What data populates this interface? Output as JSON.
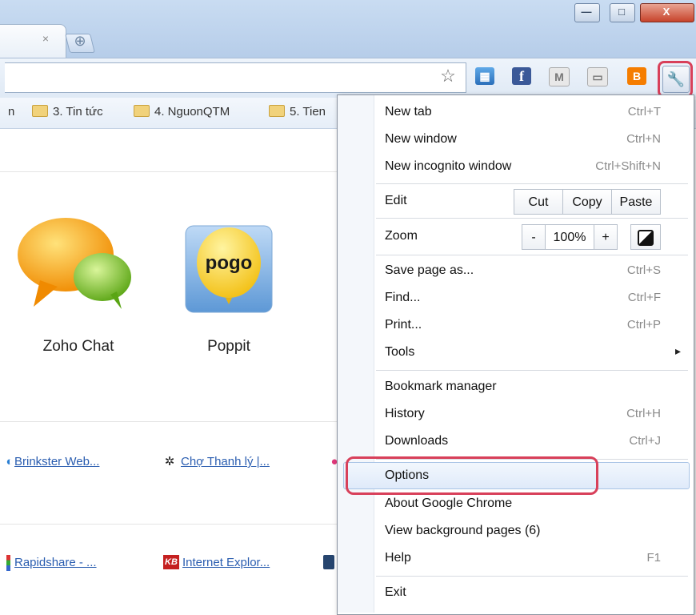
{
  "window": {
    "close_glyph": "X",
    "minimize_glyph": "—",
    "maximize_glyph": "□"
  },
  "tab": {
    "close_glyph": "×",
    "new_tab_glyph": "⊕"
  },
  "toolbar": {
    "star_glyph": "☆",
    "extensions": [
      {
        "icon": "calendar-icon",
        "glyph": "▦"
      },
      {
        "icon": "facebook-icon",
        "glyph": "f"
      },
      {
        "icon": "gmail-checker-icon",
        "glyph": "M"
      },
      {
        "icon": "chat-checker-icon",
        "glyph": "▭"
      },
      {
        "icon": "blogger-icon",
        "glyph": "B"
      }
    ],
    "wrench_glyph": "🔧",
    "highlight_color": "#d8405a"
  },
  "bookmarks": [
    {
      "label": "n"
    },
    {
      "label": "3. Tin tức"
    },
    {
      "label": "4. NguonQTM"
    },
    {
      "label": "5. Tien"
    }
  ],
  "apps": [
    {
      "label": "Zoho Chat"
    },
    {
      "label": "Poppit",
      "logo_text": "pogo"
    }
  ],
  "links": {
    "row1": [
      {
        "label": "Brinkster Web..."
      },
      {
        "label": "Chợ Thanh lý |..."
      }
    ],
    "row2": [
      {
        "label": "Rapidshare - ..."
      },
      {
        "label": "Internet Explor..."
      }
    ]
  },
  "menu": {
    "new_tab": {
      "label": "New tab",
      "shortcut": "Ctrl+T"
    },
    "new_window": {
      "label": "New window",
      "shortcut": "Ctrl+N"
    },
    "new_incognito": {
      "label": "New incognito window",
      "shortcut": "Ctrl+Shift+N"
    },
    "edit": {
      "label": "Edit",
      "cut": "Cut",
      "copy": "Copy",
      "paste": "Paste"
    },
    "zoom": {
      "label": "Zoom",
      "minus": "-",
      "value": "100%",
      "plus": "+"
    },
    "save_page": {
      "label": "Save page as...",
      "shortcut": "Ctrl+S"
    },
    "find": {
      "label": "Find...",
      "shortcut": "Ctrl+F"
    },
    "print": {
      "label": "Print...",
      "shortcut": "Ctrl+P"
    },
    "tools": {
      "label": "Tools",
      "arrow": "▸"
    },
    "bookmark_manager": {
      "label": "Bookmark manager"
    },
    "history": {
      "label": "History",
      "shortcut": "Ctrl+H"
    },
    "downloads": {
      "label": "Downloads",
      "shortcut": "Ctrl+J"
    },
    "options": {
      "label": "Options"
    },
    "about": {
      "label": "About Google Chrome"
    },
    "background_pages": {
      "label": "View background pages (6)"
    },
    "help": {
      "label": "Help",
      "shortcut": "F1"
    },
    "exit": {
      "label": "Exit"
    }
  }
}
